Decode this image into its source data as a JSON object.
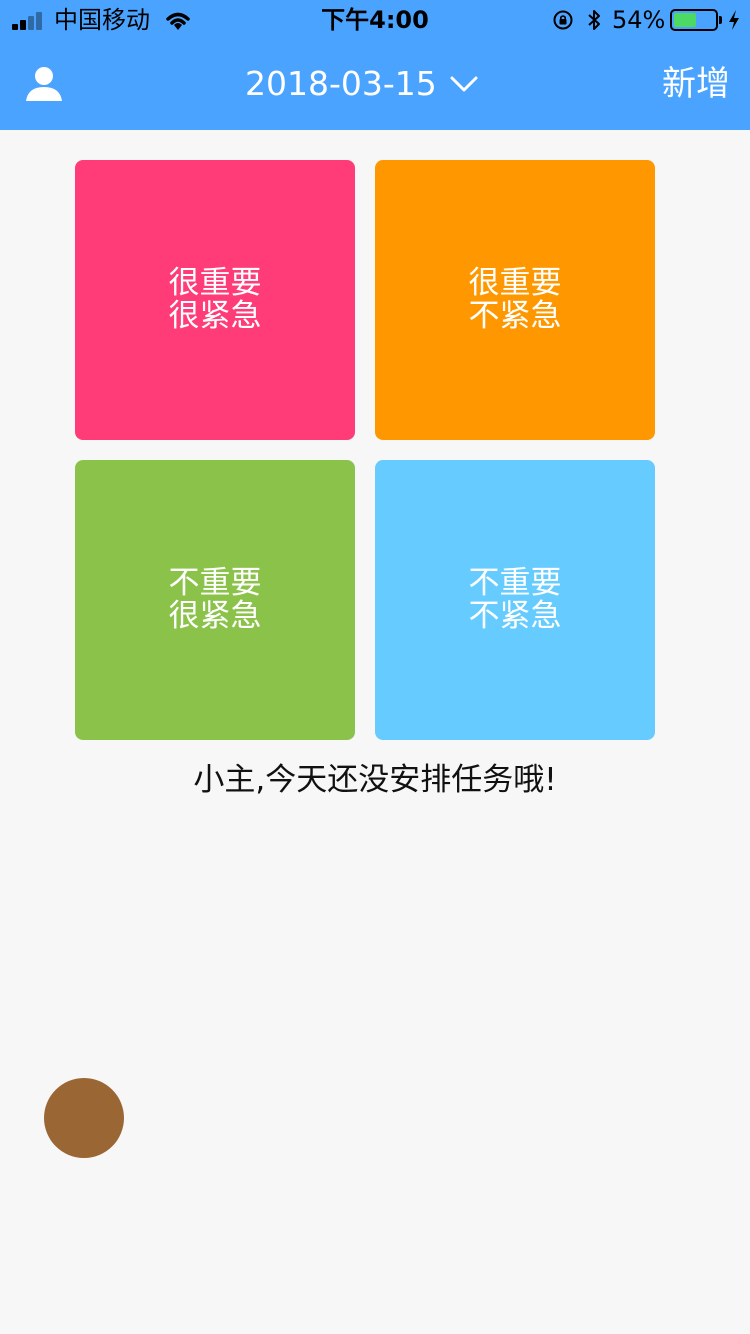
{
  "status_bar": {
    "carrier": "中国移动",
    "time": "下午4:00",
    "battery_percent_text": "54%",
    "battery_level": 0.54,
    "signal_bars_active": 2,
    "icons": [
      "signal-icon",
      "wifi-icon",
      "rotation-lock-icon",
      "bluetooth-icon",
      "battery-icon",
      "charging-icon"
    ]
  },
  "nav": {
    "date": "2018-03-15",
    "add_label": "新增",
    "icons": {
      "left": "user-icon",
      "date_dropdown": "chevron-down-icon"
    }
  },
  "quadrants": [
    {
      "line1": "很重要",
      "line2": "很紧急",
      "color": "#ff3b78"
    },
    {
      "line1": "很重要",
      "line2": "不紧急",
      "color": "#ff9800"
    },
    {
      "line1": "不重要",
      "line2": "很紧急",
      "color": "#8bc34a"
    },
    {
      "line1": "不重要",
      "line2": "不紧急",
      "color": "#66ccff"
    }
  ],
  "empty_message": "小主,今天还没安排任务哦!",
  "colors": {
    "top_bar": "#4aa3ff",
    "page_background": "#f7f7f7",
    "floating_button": "#9a6633"
  }
}
